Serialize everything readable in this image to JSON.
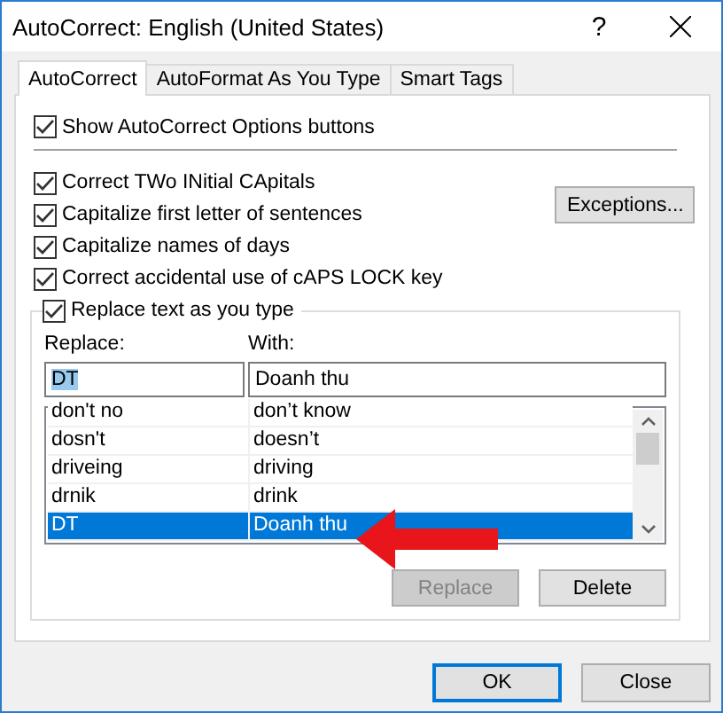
{
  "window": {
    "title": "AutoCorrect: English (United States)",
    "help": "?"
  },
  "tabs": [
    {
      "label": "AutoCorrect",
      "selected": true
    },
    {
      "label": "AutoFormat As You Type",
      "selected": false
    },
    {
      "label": "Smart Tags",
      "selected": false
    }
  ],
  "show_options": {
    "label": "Show AutoCorrect Options buttons",
    "checked": true
  },
  "options": [
    {
      "label": "Correct TWo INitial CApitals",
      "checked": true
    },
    {
      "label": "Capitalize first letter of sentences",
      "checked": true
    },
    {
      "label": "Capitalize names of days",
      "checked": true
    },
    {
      "label": "Correct accidental use of cAPS LOCK key",
      "checked": true
    }
  ],
  "exceptions_button": "Exceptions...",
  "replace_group": {
    "label": "Replace text as you type",
    "checked": true
  },
  "replace_label": "Replace:",
  "with_label": "With:",
  "replace_value": "DT",
  "with_value": "Doanh thu",
  "entries": [
    {
      "replace": "don't no",
      "with": "don’t know",
      "selected": false
    },
    {
      "replace": "dosn't",
      "with": "doesn’t",
      "selected": false
    },
    {
      "replace": "driveing",
      "with": "driving",
      "selected": false
    },
    {
      "replace": "drnik",
      "with": "drink",
      "selected": false
    },
    {
      "replace": "DT",
      "with": "Doanh thu",
      "selected": true
    }
  ],
  "list_buttons": [
    {
      "label": "Replace",
      "disabled": true
    },
    {
      "label": "Delete",
      "disabled": false
    }
  ],
  "dialog_buttons": [
    {
      "label": "OK",
      "default": true
    },
    {
      "label": "Close",
      "default": false
    }
  ]
}
